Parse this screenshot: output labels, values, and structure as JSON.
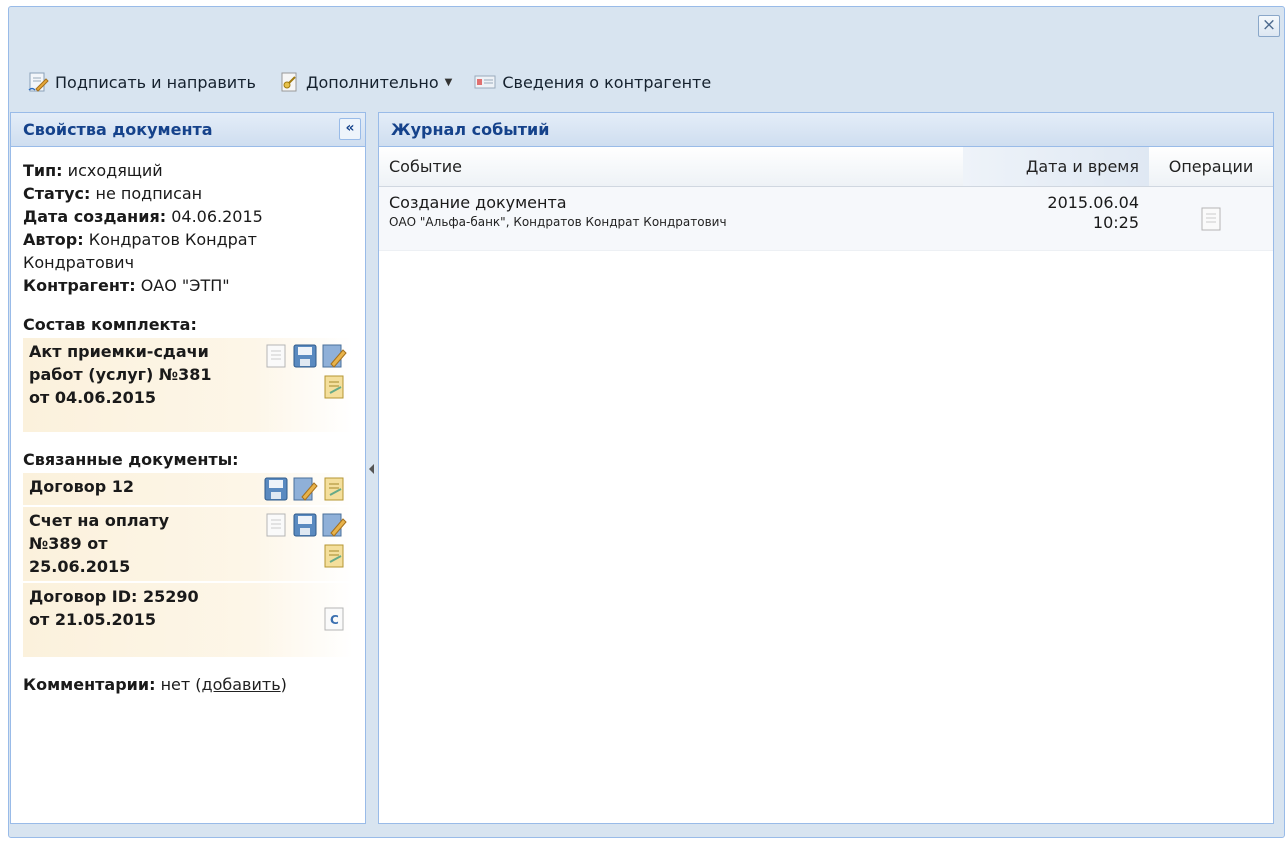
{
  "window": {
    "close_label": "×"
  },
  "toolbar": {
    "sign_send": "Подписать и направить",
    "additional": "Дополнительно",
    "counterparty_info": "Сведения о контрагенте"
  },
  "left_panel": {
    "title": "Свойства документа",
    "collapse_label": "«",
    "type_label": "Тип:",
    "type_value": "исходящий",
    "status_label": "Статус:",
    "status_value": "не подписан",
    "created_label": "Дата создания:",
    "created_value": "04.06.2015",
    "author_label": "Автор:",
    "author_value": "Кондратов Кондрат Кондратович",
    "counterparty_label": "Контрагент:",
    "counterparty_value": "ОАО \"ЭТП\"",
    "set_title": "Состав комплекта:",
    "set_items": [
      {
        "label": "Акт приемки-сдачи работ (услуг) №381 от 04.06.2015"
      }
    ],
    "related_title": "Связанные документы:",
    "related_items": [
      {
        "label": "Договор 12"
      },
      {
        "label": "Счет на оплату №389 от 25.06.2015"
      },
      {
        "label": "Договор ID: 25290 от 21.05.2015"
      }
    ],
    "comments_label": "Комментарии:",
    "comments_value": "нет",
    "comments_add": "добавить"
  },
  "right_panel": {
    "title": "Журнал событий",
    "columns": {
      "event": "Событие",
      "datetime": "Дата и время",
      "ops": "Операции"
    },
    "rows": [
      {
        "event": "Создание документа",
        "detail": "ОАО \"Альфа-банк\", Кондратов Кондрат Кондратович",
        "date": "2015.06.04",
        "time": "10:25"
      }
    ]
  },
  "colors": {
    "accent": "#15428b",
    "border": "#99bbe8",
    "highlight": "#fbf1dc"
  }
}
